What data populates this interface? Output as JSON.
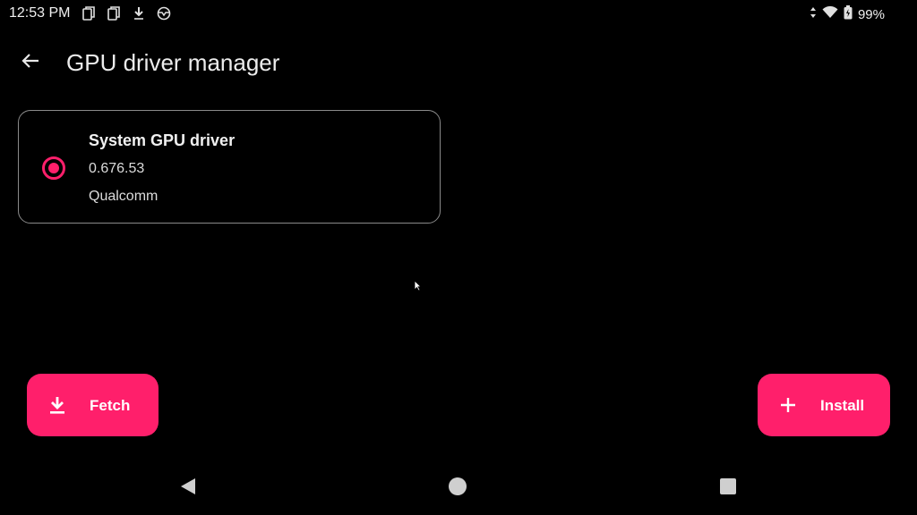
{
  "status_bar": {
    "time": "12:53 PM",
    "left_icons": [
      "copy-icon",
      "copy-icon",
      "download-icon",
      "steering-wheel-icon"
    ],
    "right_icons": [
      "data-arrows-icon",
      "wifi-icon",
      "battery-icon"
    ],
    "battery": "99%"
  },
  "app_bar": {
    "back_icon": "arrow-back-icon",
    "title": "GPU driver manager"
  },
  "driver": {
    "selected": true,
    "name": "System GPU driver",
    "version": "0.676.53",
    "vendor": "Qualcomm"
  },
  "actions": {
    "fetch": {
      "label": "Fetch",
      "icon": "download-icon"
    },
    "install": {
      "label": "Install",
      "icon": "plus-icon"
    }
  },
  "nav": {
    "back": "nav-back-icon",
    "home": "nav-home-icon",
    "recents": "nav-recents-icon"
  },
  "colors": {
    "accent": "#ff1f6b",
    "background": "#000000",
    "card_border": "#8a8a8a"
  }
}
